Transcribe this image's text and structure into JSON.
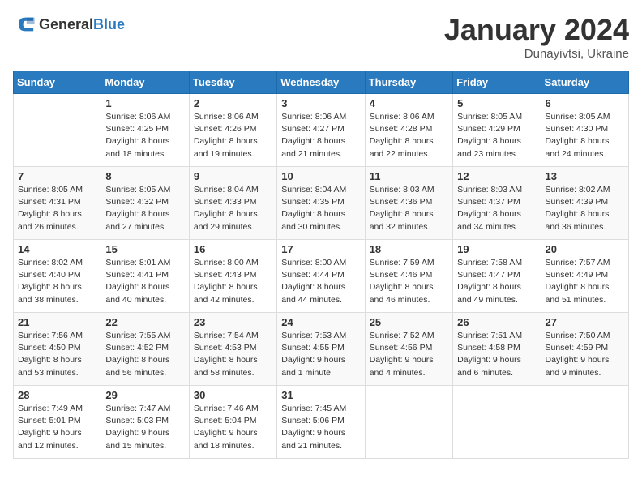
{
  "header": {
    "logo_general": "General",
    "logo_blue": "Blue",
    "month": "January 2024",
    "location": "Dunayivtsi, Ukraine"
  },
  "days_of_week": [
    "Sunday",
    "Monday",
    "Tuesday",
    "Wednesday",
    "Thursday",
    "Friday",
    "Saturday"
  ],
  "weeks": [
    [
      {
        "day": "",
        "sunrise": "",
        "sunset": "",
        "daylight": ""
      },
      {
        "day": "1",
        "sunrise": "Sunrise: 8:06 AM",
        "sunset": "Sunset: 4:25 PM",
        "daylight": "Daylight: 8 hours and 18 minutes."
      },
      {
        "day": "2",
        "sunrise": "Sunrise: 8:06 AM",
        "sunset": "Sunset: 4:26 PM",
        "daylight": "Daylight: 8 hours and 19 minutes."
      },
      {
        "day": "3",
        "sunrise": "Sunrise: 8:06 AM",
        "sunset": "Sunset: 4:27 PM",
        "daylight": "Daylight: 8 hours and 21 minutes."
      },
      {
        "day": "4",
        "sunrise": "Sunrise: 8:06 AM",
        "sunset": "Sunset: 4:28 PM",
        "daylight": "Daylight: 8 hours and 22 minutes."
      },
      {
        "day": "5",
        "sunrise": "Sunrise: 8:05 AM",
        "sunset": "Sunset: 4:29 PM",
        "daylight": "Daylight: 8 hours and 23 minutes."
      },
      {
        "day": "6",
        "sunrise": "Sunrise: 8:05 AM",
        "sunset": "Sunset: 4:30 PM",
        "daylight": "Daylight: 8 hours and 24 minutes."
      }
    ],
    [
      {
        "day": "7",
        "sunrise": "Sunrise: 8:05 AM",
        "sunset": "Sunset: 4:31 PM",
        "daylight": "Daylight: 8 hours and 26 minutes."
      },
      {
        "day": "8",
        "sunrise": "Sunrise: 8:05 AM",
        "sunset": "Sunset: 4:32 PM",
        "daylight": "Daylight: 8 hours and 27 minutes."
      },
      {
        "day": "9",
        "sunrise": "Sunrise: 8:04 AM",
        "sunset": "Sunset: 4:33 PM",
        "daylight": "Daylight: 8 hours and 29 minutes."
      },
      {
        "day": "10",
        "sunrise": "Sunrise: 8:04 AM",
        "sunset": "Sunset: 4:35 PM",
        "daylight": "Daylight: 8 hours and 30 minutes."
      },
      {
        "day": "11",
        "sunrise": "Sunrise: 8:03 AM",
        "sunset": "Sunset: 4:36 PM",
        "daylight": "Daylight: 8 hours and 32 minutes."
      },
      {
        "day": "12",
        "sunrise": "Sunrise: 8:03 AM",
        "sunset": "Sunset: 4:37 PM",
        "daylight": "Daylight: 8 hours and 34 minutes."
      },
      {
        "day": "13",
        "sunrise": "Sunrise: 8:02 AM",
        "sunset": "Sunset: 4:39 PM",
        "daylight": "Daylight: 8 hours and 36 minutes."
      }
    ],
    [
      {
        "day": "14",
        "sunrise": "Sunrise: 8:02 AM",
        "sunset": "Sunset: 4:40 PM",
        "daylight": "Daylight: 8 hours and 38 minutes."
      },
      {
        "day": "15",
        "sunrise": "Sunrise: 8:01 AM",
        "sunset": "Sunset: 4:41 PM",
        "daylight": "Daylight: 8 hours and 40 minutes."
      },
      {
        "day": "16",
        "sunrise": "Sunrise: 8:00 AM",
        "sunset": "Sunset: 4:43 PM",
        "daylight": "Daylight: 8 hours and 42 minutes."
      },
      {
        "day": "17",
        "sunrise": "Sunrise: 8:00 AM",
        "sunset": "Sunset: 4:44 PM",
        "daylight": "Daylight: 8 hours and 44 minutes."
      },
      {
        "day": "18",
        "sunrise": "Sunrise: 7:59 AM",
        "sunset": "Sunset: 4:46 PM",
        "daylight": "Daylight: 8 hours and 46 minutes."
      },
      {
        "day": "19",
        "sunrise": "Sunrise: 7:58 AM",
        "sunset": "Sunset: 4:47 PM",
        "daylight": "Daylight: 8 hours and 49 minutes."
      },
      {
        "day": "20",
        "sunrise": "Sunrise: 7:57 AM",
        "sunset": "Sunset: 4:49 PM",
        "daylight": "Daylight: 8 hours and 51 minutes."
      }
    ],
    [
      {
        "day": "21",
        "sunrise": "Sunrise: 7:56 AM",
        "sunset": "Sunset: 4:50 PM",
        "daylight": "Daylight: 8 hours and 53 minutes."
      },
      {
        "day": "22",
        "sunrise": "Sunrise: 7:55 AM",
        "sunset": "Sunset: 4:52 PM",
        "daylight": "Daylight: 8 hours and 56 minutes."
      },
      {
        "day": "23",
        "sunrise": "Sunrise: 7:54 AM",
        "sunset": "Sunset: 4:53 PM",
        "daylight": "Daylight: 8 hours and 58 minutes."
      },
      {
        "day": "24",
        "sunrise": "Sunrise: 7:53 AM",
        "sunset": "Sunset: 4:55 PM",
        "daylight": "Daylight: 9 hours and 1 minute."
      },
      {
        "day": "25",
        "sunrise": "Sunrise: 7:52 AM",
        "sunset": "Sunset: 4:56 PM",
        "daylight": "Daylight: 9 hours and 4 minutes."
      },
      {
        "day": "26",
        "sunrise": "Sunrise: 7:51 AM",
        "sunset": "Sunset: 4:58 PM",
        "daylight": "Daylight: 9 hours and 6 minutes."
      },
      {
        "day": "27",
        "sunrise": "Sunrise: 7:50 AM",
        "sunset": "Sunset: 4:59 PM",
        "daylight": "Daylight: 9 hours and 9 minutes."
      }
    ],
    [
      {
        "day": "28",
        "sunrise": "Sunrise: 7:49 AM",
        "sunset": "Sunset: 5:01 PM",
        "daylight": "Daylight: 9 hours and 12 minutes."
      },
      {
        "day": "29",
        "sunrise": "Sunrise: 7:47 AM",
        "sunset": "Sunset: 5:03 PM",
        "daylight": "Daylight: 9 hours and 15 minutes."
      },
      {
        "day": "30",
        "sunrise": "Sunrise: 7:46 AM",
        "sunset": "Sunset: 5:04 PM",
        "daylight": "Daylight: 9 hours and 18 minutes."
      },
      {
        "day": "31",
        "sunrise": "Sunrise: 7:45 AM",
        "sunset": "Sunset: 5:06 PM",
        "daylight": "Daylight: 9 hours and 21 minutes."
      },
      {
        "day": "",
        "sunrise": "",
        "sunset": "",
        "daylight": ""
      },
      {
        "day": "",
        "sunrise": "",
        "sunset": "",
        "daylight": ""
      },
      {
        "day": "",
        "sunrise": "",
        "sunset": "",
        "daylight": ""
      }
    ]
  ]
}
